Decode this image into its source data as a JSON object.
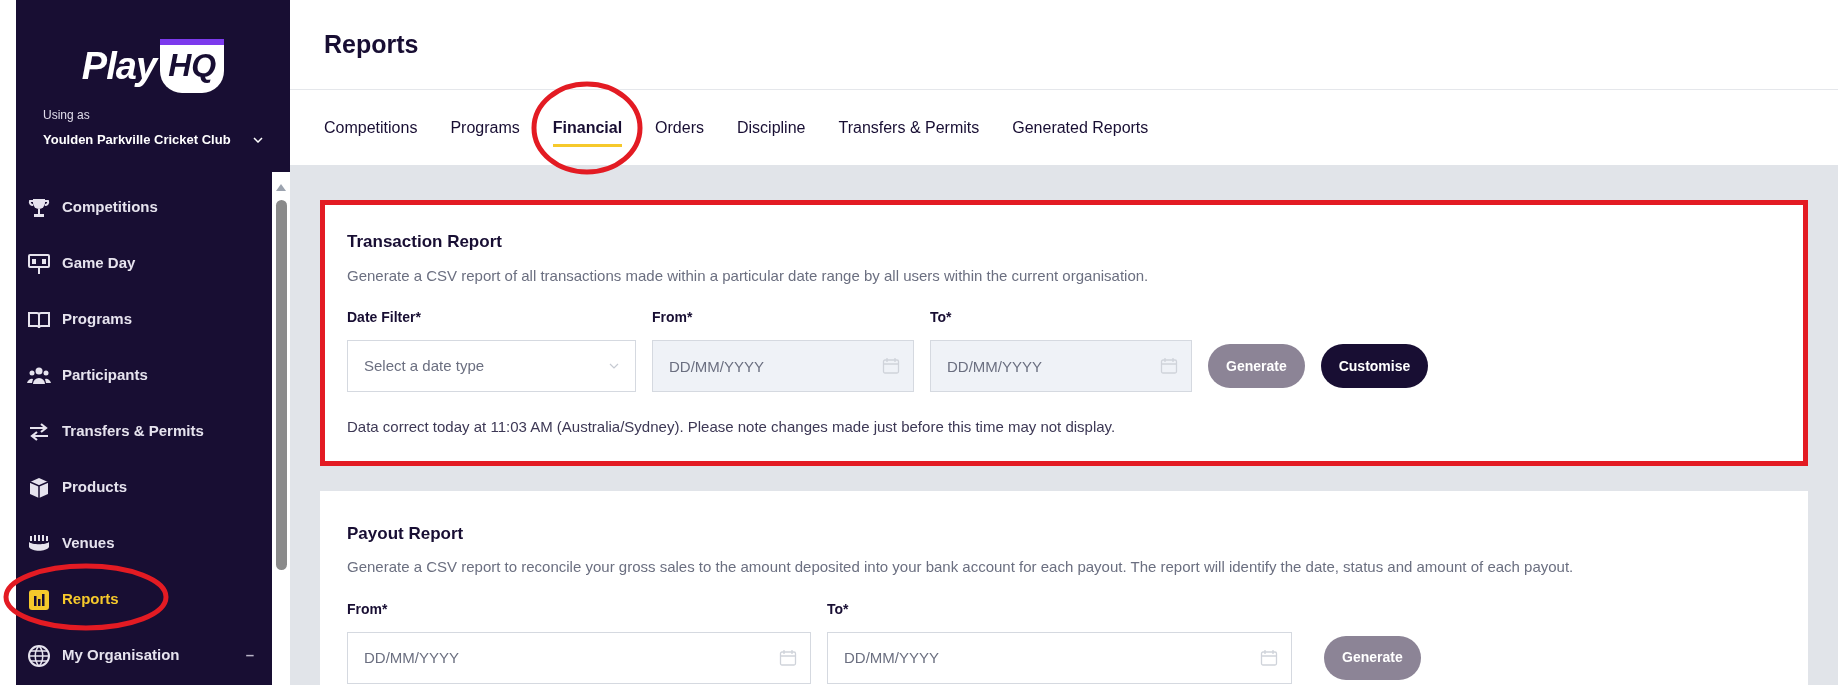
{
  "sidebar": {
    "logo": {
      "text_1": "Play",
      "text_2": "HQ"
    },
    "using_as_label": "Using as",
    "organisation": "Youlden Parkville Cricket Club",
    "items": [
      {
        "label": "Competitions",
        "selected": false
      },
      {
        "label": "Game Day",
        "selected": false
      },
      {
        "label": "Programs",
        "selected": false
      },
      {
        "label": "Participants",
        "selected": false
      },
      {
        "label": "Transfers & Permits",
        "selected": false
      },
      {
        "label": "Products",
        "selected": false
      },
      {
        "label": "Venues",
        "selected": false
      },
      {
        "label": "Reports",
        "selected": true
      },
      {
        "label": "My Organisation",
        "selected": false,
        "trailing": "–"
      }
    ]
  },
  "page": {
    "title": "Reports"
  },
  "tabs": [
    {
      "label": "Competitions",
      "selected": false
    },
    {
      "label": "Programs",
      "selected": false
    },
    {
      "label": "Financial",
      "selected": true
    },
    {
      "label": "Orders",
      "selected": false
    },
    {
      "label": "Discipline",
      "selected": false
    },
    {
      "label": "Transfers & Permits",
      "selected": false
    },
    {
      "label": "Generated Reports",
      "selected": false
    }
  ],
  "transaction_report": {
    "title": "Transaction Report",
    "description": "Generate a CSV report of all transactions made within a particular date range by all users within the current organisation.",
    "date_filter": {
      "label": "Date Filter*",
      "placeholder": "Select a date type"
    },
    "from": {
      "label": "From*",
      "placeholder": "DD/MM/YYYY"
    },
    "to": {
      "label": "To*",
      "placeholder": "DD/MM/YYYY"
    },
    "buttons": [
      {
        "label": "Generate",
        "disabled": true
      },
      {
        "label": "Customise",
        "disabled": false
      }
    ],
    "note": "Data correct today at 11:03 AM (Australia/Sydney). Please note changes made just before this time may not display."
  },
  "payout_report": {
    "title": "Payout Report",
    "description": "Generate a CSV report to reconcile your gross sales to the amount deposited into your bank account for each payout. The report will identify the date, status and amount of each payout.",
    "from": {
      "label": "From*",
      "placeholder": "DD/MM/YYYY"
    },
    "to": {
      "label": "To*",
      "placeholder": "DD/MM/YYYY"
    },
    "buttons": [
      {
        "label": "Generate",
        "disabled": true
      }
    ]
  }
}
